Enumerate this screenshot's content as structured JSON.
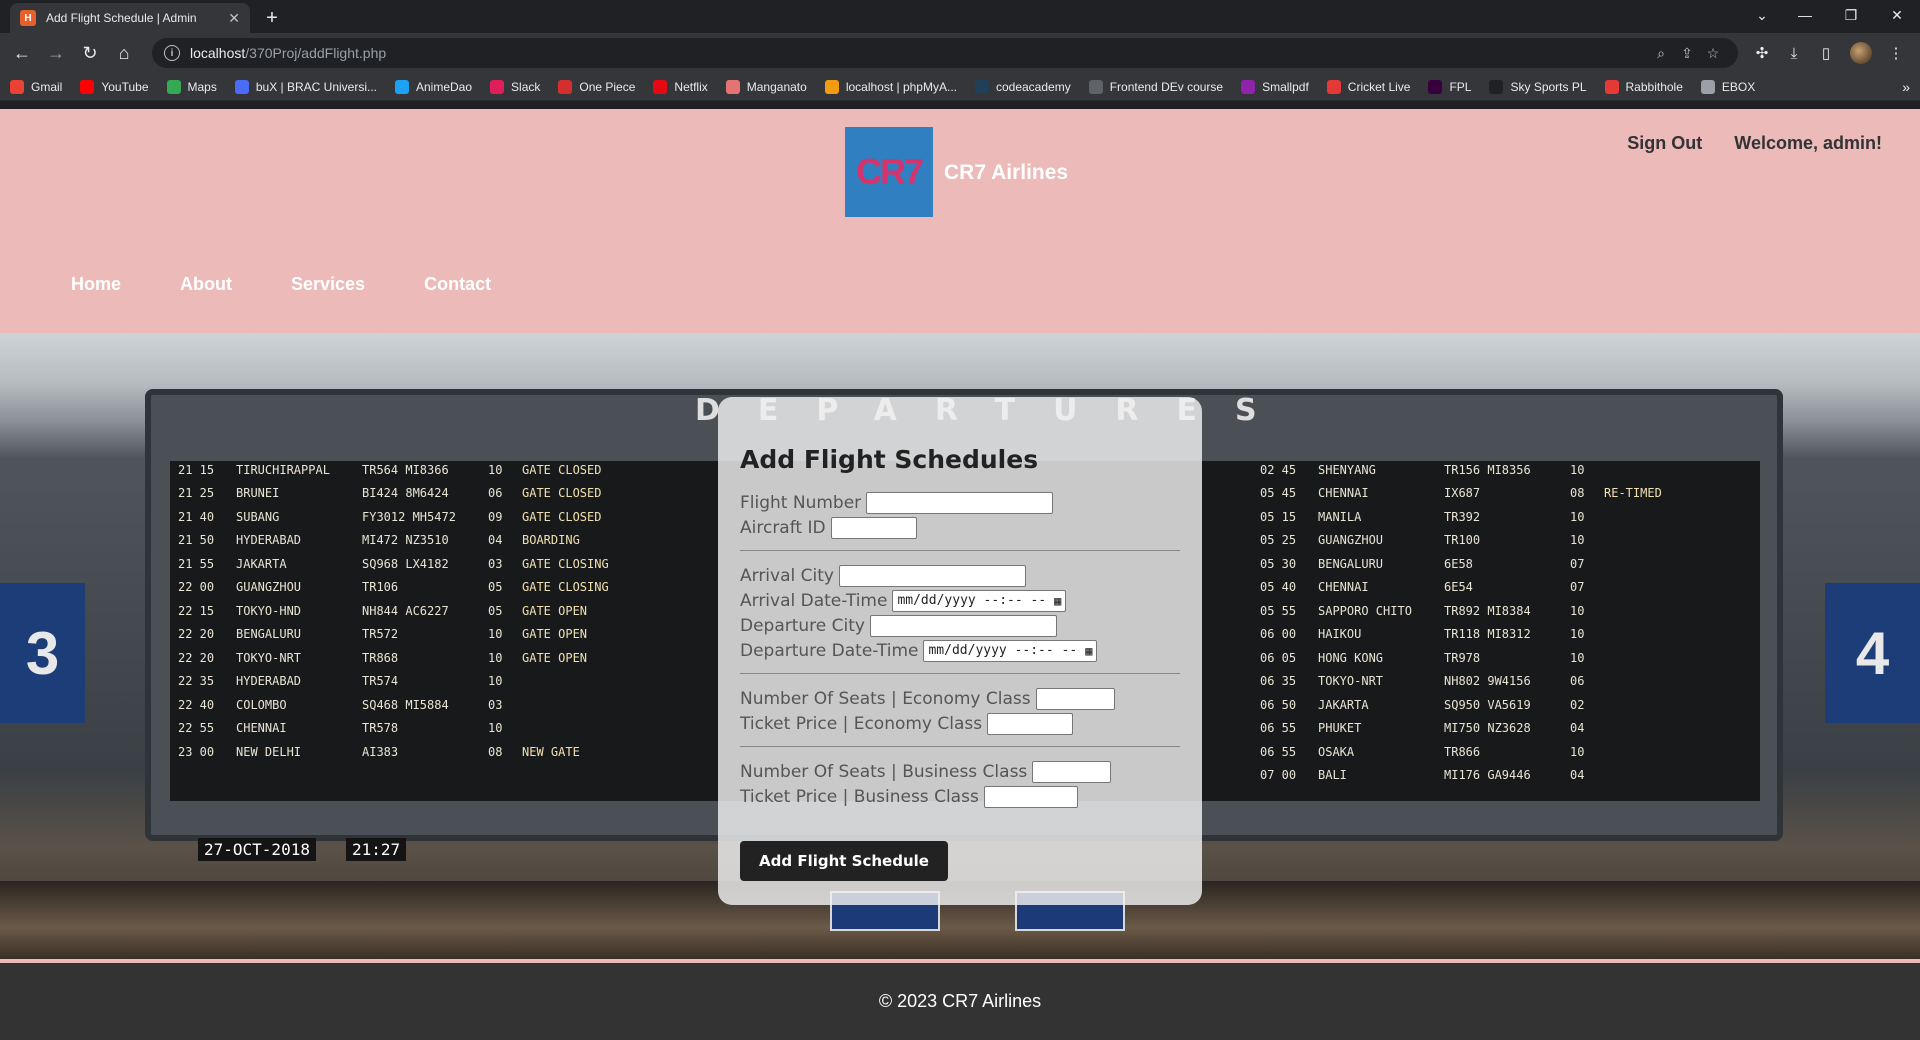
{
  "browser": {
    "tab_title": "Add Flight Schedule | Admin",
    "tab_favicon": "H",
    "url_host": "localhost",
    "url_path": "/370Proj/addFlight.php",
    "bookmarks": [
      {
        "label": "Gmail",
        "color": "#ea4335"
      },
      {
        "label": "YouTube",
        "color": "#ff0000"
      },
      {
        "label": "Maps",
        "color": "#34a853"
      },
      {
        "label": "buX | BRAC Universi...",
        "color": "#4a6cf7"
      },
      {
        "label": "AnimeDao",
        "color": "#1da1f2"
      },
      {
        "label": "Slack",
        "color": "#e01e5a"
      },
      {
        "label": "One Piece",
        "color": "#d32f2f"
      },
      {
        "label": "Netflix",
        "color": "#e50914"
      },
      {
        "label": "Manganato",
        "color": "#e57373"
      },
      {
        "label": "localhost | phpMyA...",
        "color": "#f39c12"
      },
      {
        "label": "codeacademy",
        "color": "#1f4056"
      },
      {
        "label": "Frontend DEv course",
        "color": "#5f6368"
      },
      {
        "label": "Smallpdf",
        "color": "#8e24aa"
      },
      {
        "label": "Cricket Live",
        "color": "#e53935"
      },
      {
        "label": "FPL",
        "color": "#37003c"
      },
      {
        "label": "Sky Sports PL",
        "color": "#202124"
      },
      {
        "label": "Rabbithole",
        "color": "#e53935"
      },
      {
        "label": "EBOX",
        "color": "#9aa0a6"
      }
    ]
  },
  "header": {
    "logo_text": "CR7",
    "brand": "CR7 Airlines",
    "sign_out": "Sign Out",
    "welcome": "Welcome, admin!",
    "nav": [
      "Home",
      "About",
      "Services",
      "Contact"
    ]
  },
  "board": {
    "title": "DEPARTURES",
    "date": "27-OCT-2018",
    "time": "21:27",
    "left_rows": [
      [
        "21 15",
        "TIRUCHIRAPPAL",
        "TR564  MI8366",
        "10",
        "GATE CLOSED"
      ],
      [
        "21 25",
        "BRUNEI",
        "BI424  8M6424",
        "06",
        "GATE CLOSED"
      ],
      [
        "21 40",
        "SUBANG",
        "FY3012 MH5472",
        "09",
        "GATE CLOSED"
      ],
      [
        "21 50",
        "HYDERABAD",
        "MI472  NZ3510",
        "04",
        "BOARDING"
      ],
      [
        "21 55",
        "JAKARTA",
        "SQ968  LX4182",
        "03",
        "GATE CLOSING"
      ],
      [
        "22 00",
        "GUANGZHOU",
        "TR106",
        "05",
        "GATE CLOSING"
      ],
      [
        "22 15",
        "TOKYO-HND",
        "NH844  AC6227",
        "05",
        "GATE OPEN"
      ],
      [
        "22 20",
        "BENGALURU",
        "TR572",
        "10",
        "GATE OPEN"
      ],
      [
        "22 20",
        "TOKYO-NRT",
        "TR868",
        "10",
        "GATE OPEN"
      ],
      [
        "22 35",
        "HYDERABAD",
        "TR574",
        "10",
        ""
      ],
      [
        "22 40",
        "COLOMBO",
        "SQ468  MI5884",
        "03",
        ""
      ],
      [
        "22 55",
        "CHENNAI",
        "TR578",
        "10",
        ""
      ],
      [
        "23 00",
        "NEW DELHI",
        "AI383",
        "08",
        "NEW GATE"
      ]
    ],
    "right_rows": [
      [
        "02 45",
        "SHENYANG",
        "TR156  MI8356",
        "10",
        ""
      ],
      [
        "05 45",
        "CHENNAI",
        "IX687",
        "08",
        "RE-TIMED"
      ],
      [
        "05 15",
        "MANILA",
        "TR392",
        "10",
        ""
      ],
      [
        "05 25",
        "GUANGZHOU",
        "TR100",
        "10",
        ""
      ],
      [
        "05 30",
        "BENGALURU",
        "6E58",
        "07",
        ""
      ],
      [
        "05 40",
        "CHENNAI",
        "6E54",
        "07",
        ""
      ],
      [
        "05 55",
        "SAPPORO CHITO",
        "TR892  MI8384",
        "10",
        ""
      ],
      [
        "06 00",
        "HAIKOU",
        "TR118  MI8312",
        "10",
        ""
      ],
      [
        "06 05",
        "HONG KONG",
        "TR978",
        "10",
        ""
      ],
      [
        "06 35",
        "TOKYO-NRT",
        "NH802  9W4156",
        "06",
        ""
      ],
      [
        "06 50",
        "JAKARTA",
        "SQ950  VA5619",
        "02",
        ""
      ],
      [
        "06 55",
        "PHUKET",
        "MI750  NZ3628",
        "04",
        ""
      ],
      [
        "06 55",
        "OSAKA",
        "TR866",
        "10",
        ""
      ],
      [
        "07 00",
        "BALI",
        "MI176  GA9446",
        "04",
        ""
      ]
    ],
    "gate_left": "3",
    "gate_right": "4"
  },
  "form": {
    "title": "Add Flight Schedules",
    "flight_number_label": "Flight Number",
    "aircraft_id_label": "Aircraft ID",
    "arrival_city_label": "Arrival City",
    "arrival_dt_label": "Arrival Date-Time",
    "departure_city_label": "Departure City",
    "departure_dt_label": "Departure Date-Time",
    "datetime_placeholder": "mm/dd/yyyy --:-- --",
    "econ_seats_label": "Number Of Seats | Economy Class",
    "econ_price_label": "Ticket Price | Economy Class",
    "biz_seats_label": "Number Of Seats | Business Class",
    "biz_price_label": "Ticket Price | Business Class",
    "submit_label": "Add Flight Schedule"
  },
  "footer": {
    "text": "© 2023 CR7 Airlines"
  }
}
